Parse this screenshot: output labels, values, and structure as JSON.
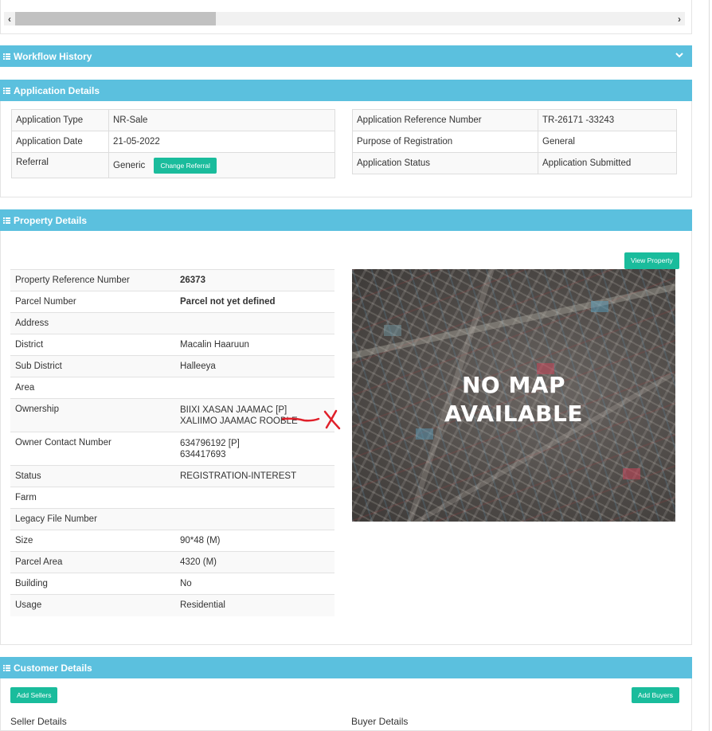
{
  "workflow_history": {
    "title": "Workflow History"
  },
  "application_details": {
    "title": "Application Details",
    "left": {
      "type_label": "Application Type",
      "type_value": "NR-Sale",
      "date_label": "Application Date",
      "date_value": "21-05-2022",
      "referral_label": "Referral",
      "referral_value": "Generic",
      "change_referral_button": "Change Referral"
    },
    "right": {
      "ref_label": "Application Reference Number",
      "ref_value": "TR-26171 -33243",
      "purpose_label": "Purpose of Registration",
      "purpose_value": "General",
      "status_label": "Application Status",
      "status_value": "Application Submitted"
    }
  },
  "property_details": {
    "title": "Property Details",
    "view_property_button": "View Property",
    "rows": [
      {
        "label": "Property Reference Number",
        "value": "26373"
      },
      {
        "label": "Parcel Number",
        "value": "Parcel not yet defined"
      },
      {
        "label": "Address",
        "value": ""
      },
      {
        "label": "District",
        "value": "Macalin Haaruun"
      },
      {
        "label": "Sub District",
        "value": "Halleeya"
      },
      {
        "label": "Area",
        "value": ""
      },
      {
        "label": "Ownership",
        "value": "BIIXI XASAN JAAMAC [P]",
        "value2": "XALIIMO JAAMAC ROOBLE"
      },
      {
        "label": "Owner Contact Number",
        "value": "634796192 [P]",
        "value2": "634417693"
      },
      {
        "label": "Status",
        "value": "REGISTRATION-INTEREST"
      },
      {
        "label": "Farm",
        "value": ""
      },
      {
        "label": "Legacy File Number",
        "value": ""
      },
      {
        "label": "Size",
        "value": "90*48 (M)"
      },
      {
        "label": "Parcel Area",
        "value": "4320 (M)"
      },
      {
        "label": "Building",
        "value": "No"
      },
      {
        "label": "Usage",
        "value": "Residential"
      }
    ],
    "map_text_line1": "NO MAP",
    "map_text_line2": "AVAILABLE",
    "annotation_color": "#e0202a"
  },
  "customer_details": {
    "title": "Customer Details",
    "add_sellers_button": "Add Sellers",
    "add_buyers_button": "Add Buyers",
    "seller_details_label": "Seller Details",
    "buyer_details_label": "Buyer Details"
  },
  "colors": {
    "panel_header": "#5bc0de",
    "button": "#1abc9c"
  }
}
